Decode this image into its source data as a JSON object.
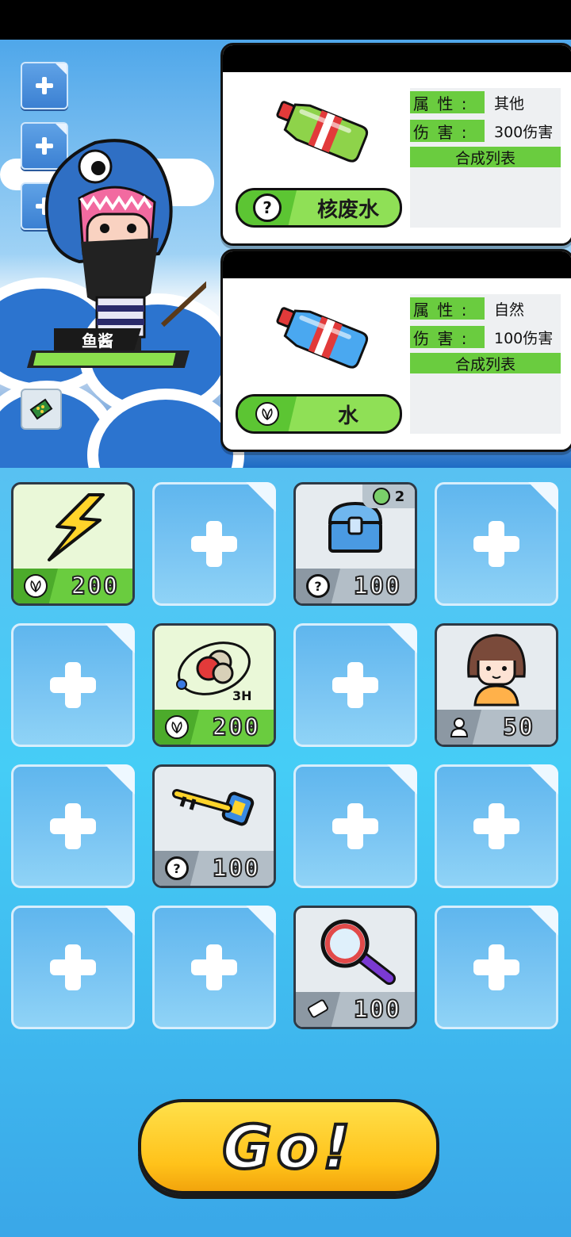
{
  "character": {
    "name": "鱼酱",
    "hp_fraction": 0.95
  },
  "cards": [
    {
      "item_name": "核废水",
      "icon": "question-icon",
      "bottle_color": "#8ed34a",
      "attr_label": "属 性 :",
      "attr_value": "其他",
      "damage_label": "伤 害 :",
      "damage_value": "300伤害",
      "list_label": "合成列表"
    },
    {
      "item_name": "水",
      "icon": "leaf-icon",
      "bottle_color": "#4aa8f0",
      "attr_label": "属 性 :",
      "attr_value": "自然",
      "damage_label": "伤 害 :",
      "damage_value": "100伤害",
      "list_label": "合成列表"
    }
  ],
  "grid": [
    {
      "type": "item",
      "style": "green",
      "art": "lightning-icon",
      "cost_icon": "leaf-icon",
      "cost": "200"
    },
    {
      "type": "empty"
    },
    {
      "type": "item",
      "style": "gray",
      "art": "treasure-chest-icon",
      "cost_icon": "question-icon",
      "cost": "100",
      "badge_count": "2"
    },
    {
      "type": "empty"
    },
    {
      "type": "empty"
    },
    {
      "type": "item",
      "style": "green",
      "art": "atom-3h-icon",
      "cost_icon": "leaf-icon",
      "cost": "200",
      "art_label": "3H"
    },
    {
      "type": "empty"
    },
    {
      "type": "item",
      "style": "gray",
      "art": "girl-avatar-icon",
      "cost_icon": "person-icon",
      "cost": "50"
    },
    {
      "type": "empty"
    },
    {
      "type": "item",
      "style": "gray",
      "art": "key-icon",
      "cost_icon": "question-icon",
      "cost": "100"
    },
    {
      "type": "empty"
    },
    {
      "type": "empty"
    },
    {
      "type": "empty"
    },
    {
      "type": "empty"
    },
    {
      "type": "item",
      "style": "gray",
      "art": "magnifier-icon",
      "cost_icon": "eraser-icon",
      "cost": "100"
    },
    {
      "type": "empty"
    }
  ],
  "go_label": "Go!"
}
